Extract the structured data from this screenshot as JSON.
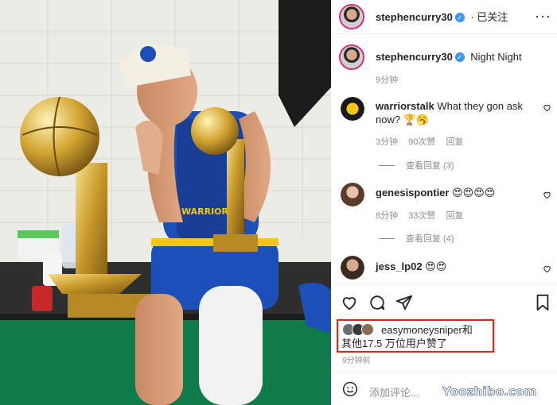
{
  "header": {
    "username": "stephencurry30",
    "follow_status": "· 已关注",
    "more_icon": "more-horizontal-icon"
  },
  "caption": {
    "username": "stephencurry30",
    "text": "Night Night",
    "time": "9分钟"
  },
  "comments": [
    {
      "username": "warriorstalk",
      "text": "What they gon ask now? 🏆🥱",
      "time": "3分钟",
      "likes": "90次赞",
      "reply": "回复",
      "view_replies": "查看回复 (3)"
    },
    {
      "username": "genesispontier",
      "text": "😍😍😍😍",
      "time": "8分钟",
      "likes": "33次赞",
      "reply": "回复",
      "view_replies": "查看回复 (4)"
    },
    {
      "username": "jess_lp02",
      "text": "😍😍"
    }
  ],
  "likes": {
    "line1": "easymoneysniper和",
    "line2": "其他17.5 万位用户赞了"
  },
  "post_time": "9分钟前",
  "add_comment": {
    "placeholder": "添加评论..."
  },
  "watermark": "Yoozhibo.com",
  "colors": {
    "verified": "#3897f0",
    "highlight_box": "#e2231a",
    "meta_text": "#8e8e8e"
  }
}
